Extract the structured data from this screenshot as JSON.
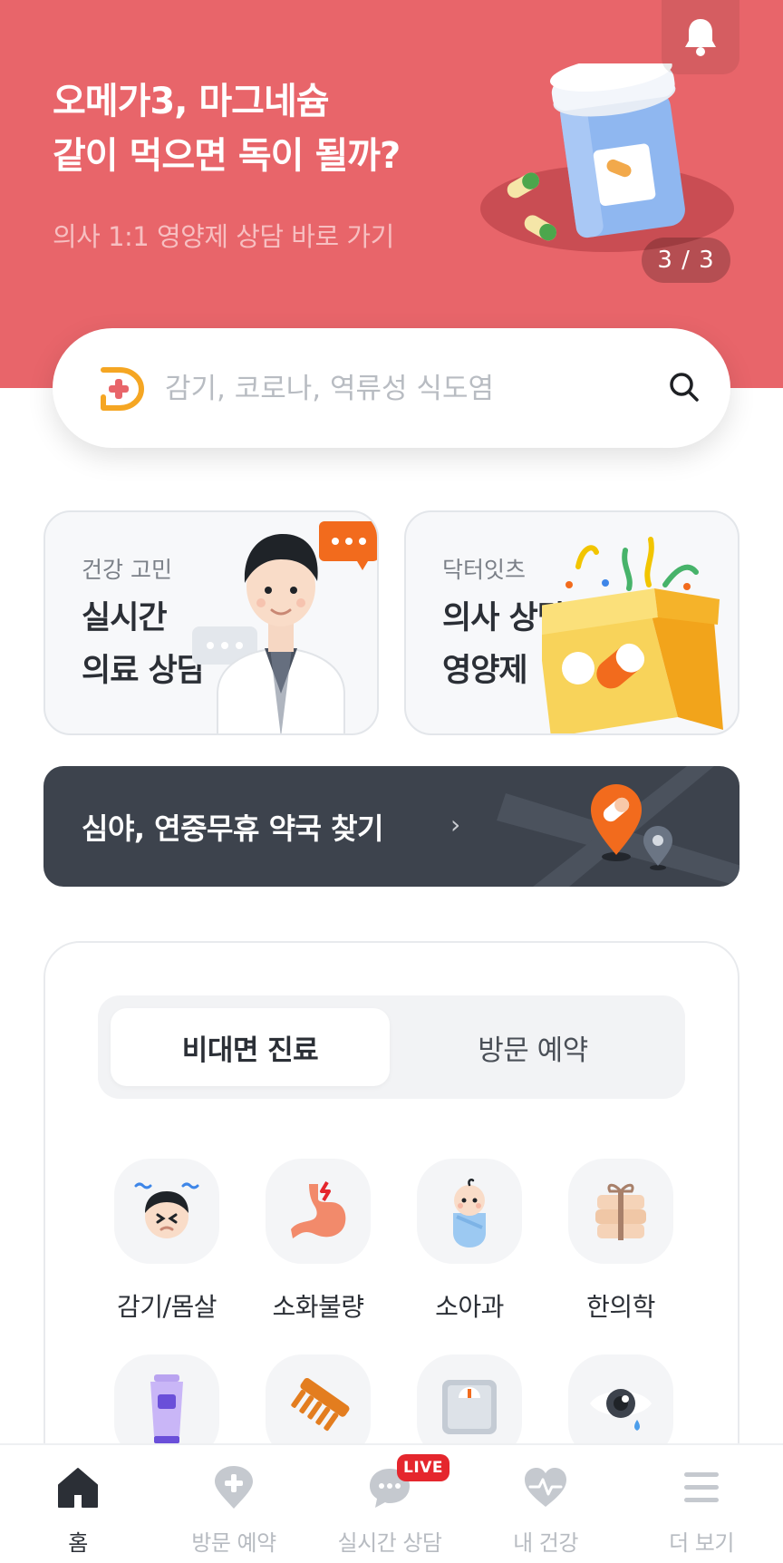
{
  "banner": {
    "title_line1": "오메가3, 마그네슘",
    "title_line2": "같이 먹으면 독이 될까?",
    "subtitle": "의사 1:1 영양제 상담 바로 가기",
    "counter": "3 / 3",
    "bg_color": "#E8656A",
    "bell_icon": "bell-icon"
  },
  "search": {
    "placeholder": "감기, 코로나, 역류성 식도염",
    "logo_icon": "doctor-now-logo",
    "search_icon": "search-icon",
    "accent": "#F5A623"
  },
  "cards": [
    {
      "kicker": "건강 고민",
      "title_line1": "실시간",
      "title_line2": "의료 상담",
      "icon": "doctor-illustration"
    },
    {
      "kicker": "닥터잇츠",
      "title_line1": "의사 상담",
      "title_line2": "영양제",
      "icon": "gift-box-illustration"
    }
  ],
  "pharmacy": {
    "label": "심야, 연중무휴 약국 찾기",
    "chevron": "›",
    "icon": "map-pin-icon"
  },
  "segment": {
    "tabs": [
      {
        "label": "비대면 진료",
        "selected": true
      },
      {
        "label": "방문 예약",
        "selected": false
      }
    ]
  },
  "categories": [
    {
      "label": "감기/몸살",
      "icon": "sick-face-icon"
    },
    {
      "label": "소화불량",
      "icon": "stomach-icon"
    },
    {
      "label": "소아과",
      "icon": "baby-icon"
    },
    {
      "label": "한의학",
      "icon": "herbal-medicine-icon"
    },
    {
      "label": "",
      "icon": "cream-tube-icon"
    },
    {
      "label": "",
      "icon": "comb-icon"
    },
    {
      "label": "",
      "icon": "scale-icon"
    },
    {
      "label": "",
      "icon": "eye-icon"
    }
  ],
  "bottom_nav": [
    {
      "label": "홈",
      "icon": "home-icon",
      "active": true
    },
    {
      "label": "방문 예약",
      "icon": "location-plus-icon",
      "active": false
    },
    {
      "label": "실시간 상담",
      "icon": "chat-bubble-icon",
      "active": false,
      "badge": "LIVE"
    },
    {
      "label": "내 건강",
      "icon": "heart-pulse-icon",
      "active": false
    },
    {
      "label": "더 보기",
      "icon": "menu-icon",
      "active": false
    }
  ]
}
